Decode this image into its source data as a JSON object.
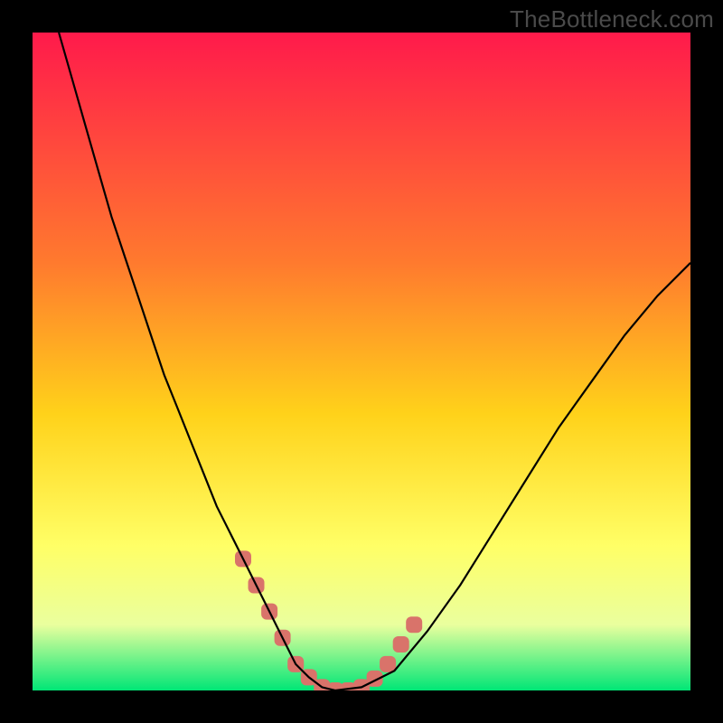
{
  "watermark": "TheBottleneck.com",
  "colors": {
    "frame": "#000000",
    "gradient_top": "#ff1a4b",
    "gradient_mid_upper": "#ff7a2e",
    "gradient_mid": "#ffd21a",
    "gradient_low": "#ffff66",
    "gradient_band": "#eaff9e",
    "gradient_bottom": "#00e676",
    "curve": "#000000",
    "marker": "#d9736a"
  },
  "chart_data": {
    "type": "line",
    "title": "",
    "xlabel": "",
    "ylabel": "",
    "xlim": [
      0,
      100
    ],
    "ylim": [
      0,
      100
    ],
    "grid": false,
    "legend": false,
    "series": [
      {
        "name": "bottleneck-curve",
        "x": [
          4,
          6,
          8,
          10,
          12,
          14,
          16,
          18,
          20,
          22,
          24,
          26,
          28,
          30,
          32,
          34,
          36,
          38,
          40,
          42,
          44,
          46,
          50,
          55,
          60,
          65,
          70,
          75,
          80,
          85,
          90,
          95,
          100
        ],
        "y": [
          100,
          93,
          86,
          79,
          72,
          66,
          60,
          54,
          48,
          43,
          38,
          33,
          28,
          24,
          20,
          16,
          12,
          8,
          4,
          2,
          0.5,
          0,
          0.5,
          3,
          9,
          16,
          24,
          32,
          40,
          47,
          54,
          60,
          65
        ]
      }
    ],
    "markers": {
      "name": "highlight-band",
      "x": [
        32,
        34,
        36,
        38,
        40,
        42,
        44,
        46,
        48,
        50,
        52,
        54,
        56,
        58
      ],
      "y": [
        20,
        16,
        12,
        8,
        4,
        2,
        0.5,
        0,
        0,
        0.5,
        1.8,
        4,
        7,
        10
      ]
    }
  }
}
